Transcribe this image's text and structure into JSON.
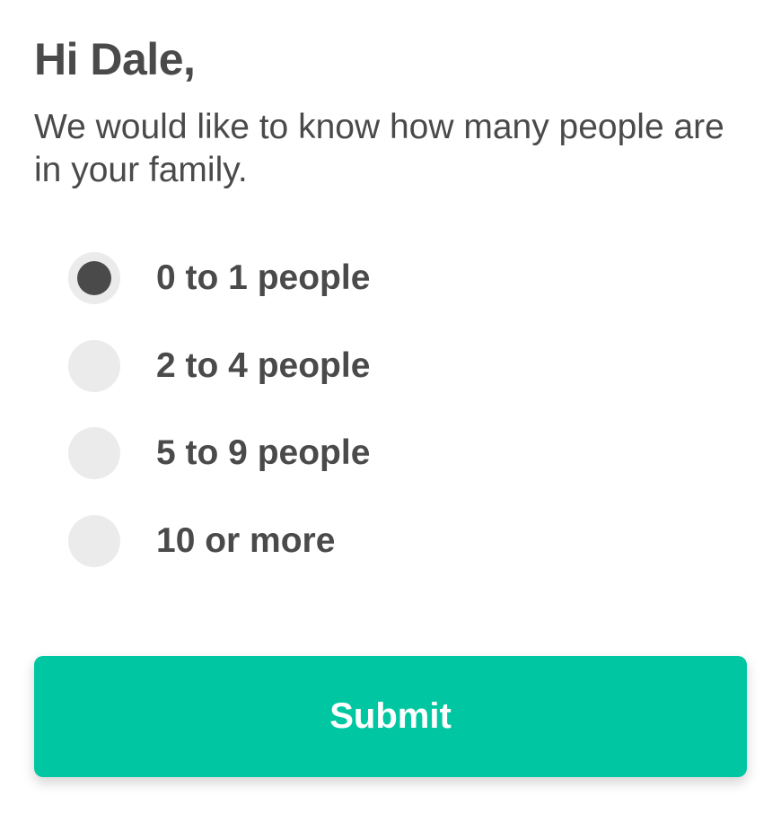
{
  "greeting": "Hi Dale,",
  "question": "We would like to know how many people are in your family.",
  "options": [
    {
      "label": "0 to 1 people",
      "selected": true
    },
    {
      "label": "2 to 4 people",
      "selected": false
    },
    {
      "label": "5 to 9 people",
      "selected": false
    },
    {
      "label": "10 or more",
      "selected": false
    }
  ],
  "submit_label": "Submit",
  "colors": {
    "accent": "#00c7a1",
    "text": "#4a4a4a",
    "radio_bg": "#ebebeb",
    "radio_dot": "#4a4a4a"
  }
}
